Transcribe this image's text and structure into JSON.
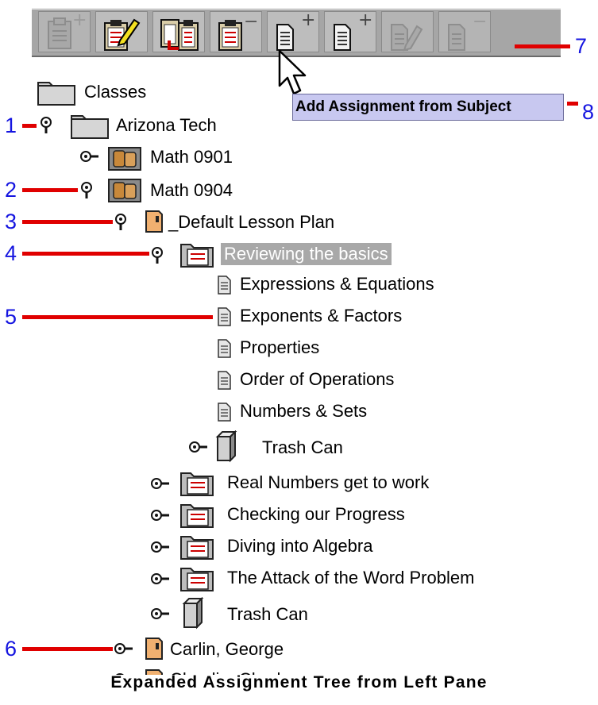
{
  "toolbar": {
    "buttons": [
      {
        "name": "add-class-button",
        "icon": "clipboard-add-icon",
        "enabled": false
      },
      {
        "name": "edit-class-button",
        "icon": "clipboard-edit-icon",
        "enabled": true
      },
      {
        "name": "copy-class-button",
        "icon": "clipboard-copy-icon",
        "enabled": true
      },
      {
        "name": "remove-class-button",
        "icon": "clipboard-remove-icon",
        "enabled": true
      },
      {
        "name": "add-assignment-from-subject-button",
        "icon": "document-add-icon",
        "enabled": true
      },
      {
        "name": "add-assignment-button",
        "icon": "document-add-icon",
        "enabled": true
      },
      {
        "name": "edit-assignment-button",
        "icon": "document-edit-icon",
        "enabled": false
      },
      {
        "name": "remove-assignment-button",
        "icon": "document-remove-icon",
        "enabled": false
      }
    ],
    "plus_symbol": "+",
    "minus_symbol": "−"
  },
  "tooltip": {
    "text": "Add Assignment from Subject"
  },
  "tree": {
    "root": "Classes",
    "school": "Arizona Tech",
    "classes": [
      "Math 0901",
      "Math 0904"
    ],
    "lesson_plan": "_Default Lesson Plan",
    "selected_unit": "Reviewing the basics",
    "assignments": [
      "Expressions & Equations",
      "Exponents & Factors",
      "Properties",
      "Order of Operations",
      "Numbers & Sets"
    ],
    "inner_trash": "Trash Can",
    "units": [
      "Real Numbers get to work",
      "Checking our Progress",
      "Diving into Algebra",
      "The Attack of the Word Problem"
    ],
    "outer_trash": "Trash Can",
    "students": [
      "Carlin, George",
      "Chaplin, Charles"
    ]
  },
  "callouts": [
    "1",
    "2",
    "3",
    "4",
    "5",
    "6",
    "7",
    "8"
  ],
  "caption": "Expanded Assignment Tree from Left Pane",
  "colors": {
    "callout_line": "#e00000",
    "callout_number": "#1515e0",
    "tooltip_bg": "#c8c8f0",
    "selection_bg": "#a8a8a8"
  }
}
